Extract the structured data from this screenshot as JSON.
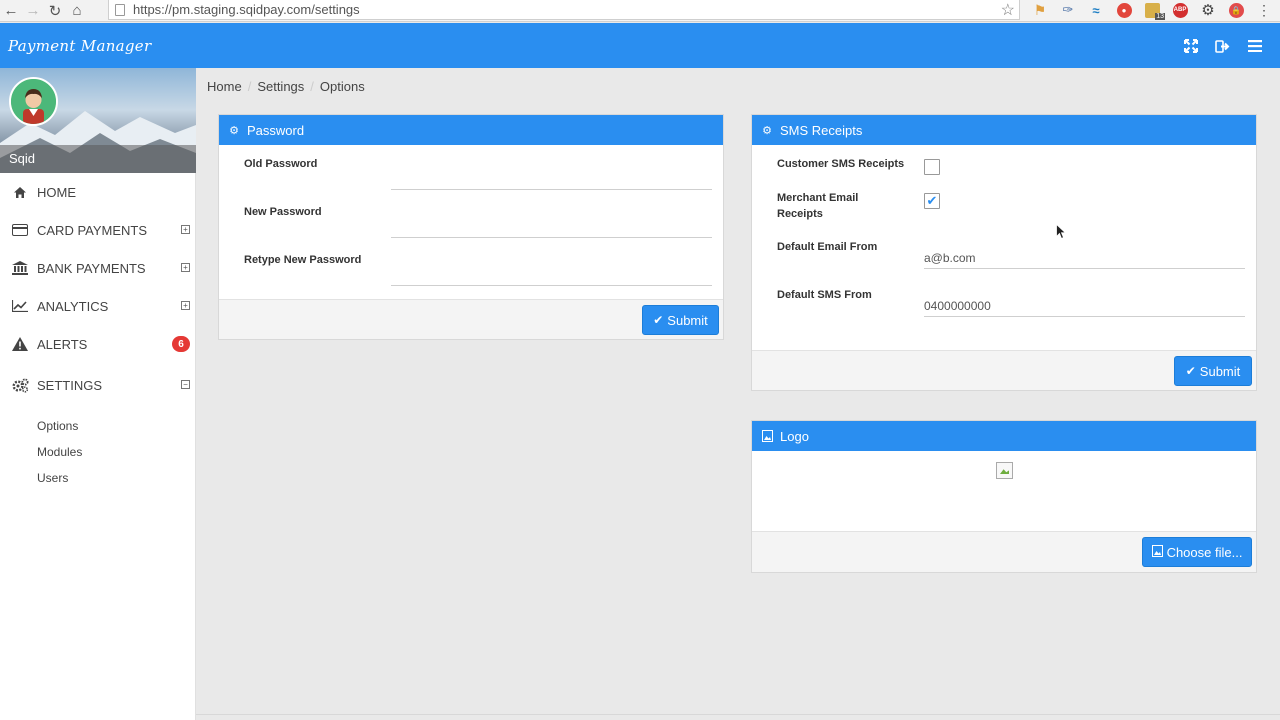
{
  "browser": {
    "url": "https://pm.staging.sqidpay.com/settings",
    "ext_badge_count": "13",
    "abp_label": "ABP"
  },
  "app": {
    "title": "Payment Manager"
  },
  "profile": {
    "name": "Sqid"
  },
  "sidebar": {
    "items": [
      {
        "label": "HOME",
        "icon": "home-icon"
      },
      {
        "label": "CARD PAYMENTS",
        "icon": "credit-card-icon",
        "toggle": "+"
      },
      {
        "label": "BANK PAYMENTS",
        "icon": "bank-icon",
        "toggle": "+"
      },
      {
        "label": "ANALYTICS",
        "icon": "line-chart-icon",
        "toggle": "+"
      },
      {
        "label": "ALERTS",
        "icon": "warning-icon",
        "badge": "6"
      },
      {
        "label": "SETTINGS",
        "icon": "gears-icon",
        "toggle": "−"
      }
    ],
    "submenu": [
      {
        "label": "Options"
      },
      {
        "label": "Modules"
      },
      {
        "label": "Users"
      }
    ]
  },
  "breadcrumb": [
    "Home",
    "Settings",
    "Options"
  ],
  "password_panel": {
    "title": "Password",
    "fields": [
      {
        "label": "Old Password",
        "value": ""
      },
      {
        "label": "New Password",
        "value": ""
      },
      {
        "label": "Retype New Password",
        "value": ""
      }
    ],
    "submit_label": "Submit"
  },
  "sms_panel": {
    "title": "SMS Receipts",
    "customer_sms_label": "Customer SMS Receipts",
    "customer_sms_checked": false,
    "merchant_email_label_line1": "Merchant Email",
    "merchant_email_label_line2": "Receipts",
    "merchant_email_checked": true,
    "email_from_label": "Default Email From",
    "email_from_value": "a@b.com",
    "sms_from_label": "Default SMS From",
    "sms_from_value": "0400000000",
    "submit_label": "Submit"
  },
  "logo_panel": {
    "title": "Logo",
    "choose_label": "Choose file..."
  },
  "colors": {
    "accent": "#2a8ef0",
    "badge": "#e53935"
  }
}
